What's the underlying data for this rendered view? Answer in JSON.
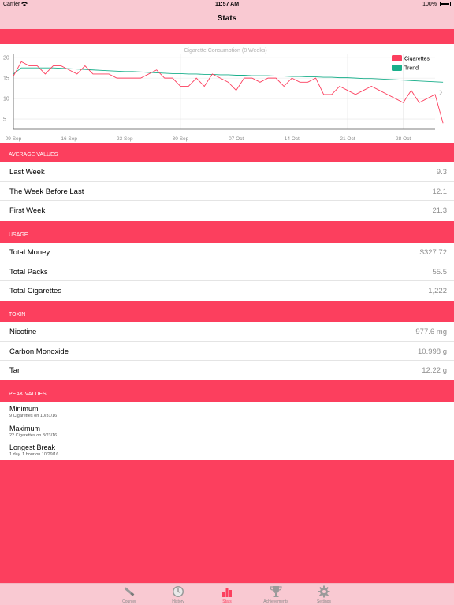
{
  "status_bar": {
    "carrier": "Carrier",
    "time": "11:57 AM",
    "battery": "100%"
  },
  "nav": {
    "title": "Stats"
  },
  "chart_data": {
    "type": "line",
    "title": "Cigarette Consumption (8 Weeks)",
    "xlabel": "",
    "ylabel": "",
    "x_ticks": [
      "09 Sep",
      "16 Sep",
      "23 Sep",
      "30 Sep",
      "07 Oct",
      "14 Oct",
      "21 Oct",
      "28 Oct"
    ],
    "y_ticks": [
      20,
      15,
      10,
      5
    ],
    "ylim": [
      2.5,
      21
    ],
    "x_range": [
      0,
      53
    ],
    "grid": true,
    "legend_position": "top-right",
    "series": [
      {
        "name": "Cigarettes",
        "color": "#fc3f5e",
        "values": [
          15.5,
          19,
          18,
          18,
          16,
          18,
          18,
          17,
          16,
          18,
          16,
          16,
          16,
          15,
          15,
          15,
          15,
          16,
          17,
          15,
          15,
          13,
          13,
          15,
          13,
          16,
          15,
          14,
          12,
          15,
          15,
          14,
          15,
          15,
          13,
          15,
          14,
          14,
          15,
          11,
          11,
          13,
          12,
          11,
          12,
          13,
          12,
          11,
          10,
          9,
          12,
          9,
          10,
          11,
          4
        ]
      },
      {
        "name": "Trend",
        "color": "#1aaf8b",
        "values": [
          16,
          17.5,
          17.5,
          17.5,
          17.5,
          17.5,
          17.4,
          17.3,
          17.2,
          17.1,
          17.0,
          16.9,
          16.8,
          16.7,
          16.6,
          16.6,
          16.5,
          16.4,
          16.3,
          16.2,
          16.1,
          16.1,
          16.0,
          16.0,
          15.9,
          15.9,
          15.8,
          15.8,
          15.7,
          15.7,
          15.6,
          15.6,
          15.6,
          15.5,
          15.5,
          15.4,
          15.4,
          15.3,
          15.3,
          15.2,
          15.2,
          15.1,
          15.1,
          15.0,
          14.9,
          14.9,
          14.8,
          14.7,
          14.6,
          14.5,
          14.4,
          14.3,
          14.2,
          14.1,
          14.0
        ]
      }
    ]
  },
  "sections": {
    "average": {
      "header": "AVERAGE VALUES",
      "rows": [
        {
          "label": "Last Week",
          "value": "9.3"
        },
        {
          "label": "The Week Before Last",
          "value": "12.1"
        },
        {
          "label": "First Week",
          "value": "21.3"
        }
      ]
    },
    "usage": {
      "header": "USAGE",
      "rows": [
        {
          "label": "Total Money",
          "value": "$327.72"
        },
        {
          "label": "Total Packs",
          "value": "55.5"
        },
        {
          "label": "Total Cigarettes",
          "value": "1,222"
        }
      ]
    },
    "toxin": {
      "header": "TOXIN",
      "rows": [
        {
          "label": "Nicotine",
          "value": "977.6 mg"
        },
        {
          "label": "Carbon Monoxide",
          "value": "10.998 g"
        },
        {
          "label": "Tar",
          "value": "12.22 g"
        }
      ]
    },
    "peak": {
      "header": "PEAK VALUES",
      "rows": [
        {
          "label": "Minimum",
          "sub": "9 Cigarettes on 10/31/16"
        },
        {
          "label": "Maximum",
          "sub": "22 Cigarettes on 8/23/16"
        },
        {
          "label": "Longest Break",
          "sub": "1 day, 1 hour on 10/29/16"
        }
      ]
    }
  },
  "tabs": [
    {
      "label": "Counter",
      "icon": "cigarette-icon",
      "active": false
    },
    {
      "label": "History",
      "icon": "clock-icon",
      "active": false
    },
    {
      "label": "Stats",
      "icon": "bar-chart-icon",
      "active": true
    },
    {
      "label": "Achievements",
      "icon": "trophy-icon",
      "active": false
    },
    {
      "label": "Settings",
      "icon": "gear-icon",
      "active": false
    }
  ],
  "colors": {
    "accent": "#fc3f5e",
    "bar_background": "#f9c9d2",
    "trend": "#1aaf8b",
    "inactive_icon": "#9a9a9a"
  }
}
